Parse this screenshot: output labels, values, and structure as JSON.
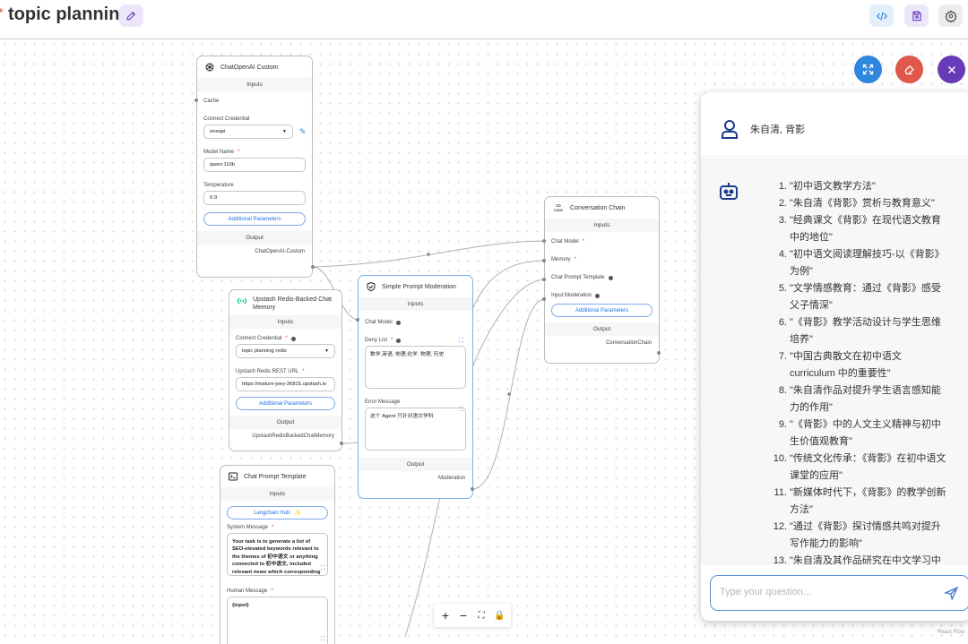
{
  "header": {
    "unsaved_marker": "*",
    "title": "topic planning"
  },
  "colors": {
    "accent_purple": "#673ab7",
    "expand_fab": "#2e86de",
    "clear_fab": "#e0584a",
    "close_fab": "#673ab7"
  },
  "nodes": {
    "chatopenai": {
      "title": "ChatOpenAI Custom",
      "inputs_label": "Inputs",
      "cache_label": "Cache",
      "credential_label": "Connect Credential",
      "credential_value": "oneapi",
      "model_label": "Model Name",
      "model_value": "qwen:110b",
      "temperature_label": "Temperature",
      "temperature_value": "0.9",
      "additional_params": "Additional Parameters",
      "output_label": "Output",
      "output_name": "ChatOpenAI-Custom"
    },
    "redis": {
      "title": "Upstash Redis-Backed Chat Memory",
      "inputs_label": "Inputs",
      "credential_label": "Connect Credential",
      "credential_value": "topic planning redis",
      "url_label": "Upstash Redis REST URL",
      "url_value": "https://mature-joey-36815.upstash.io",
      "additional_params": "Additional Parameters",
      "output_label": "Output",
      "output_name": "UpstashRedisBackedChatMemory"
    },
    "moderation": {
      "title": "Simple Prompt Moderation",
      "inputs_label": "Inputs",
      "chat_model_label": "Chat Model",
      "deny_label": "Deny List",
      "deny_value": "数学,英语, 地理,化学, 物理, 历史",
      "error_label": "Error Message",
      "error_value": "这个 Agent 只针对语文学科",
      "output_label": "Output",
      "output_name": "Moderation"
    },
    "conversation": {
      "icon_text": "CONV",
      "title": "Conversation Chain",
      "inputs_label": "Inputs",
      "chat_model_label": "Chat Model",
      "memory_label": "Memory",
      "prompt_label": "Chat Prompt Template",
      "moderation_label": "Input Moderation",
      "additional_params": "Additional Parameters",
      "output_label": "Output",
      "output_name": "ConversationChain"
    },
    "prompt": {
      "title": "Chat Prompt Template",
      "inputs_label": "Inputs",
      "hub_label": "Langchain Hub",
      "system_label": "System Message",
      "system_value": "Your task is to generate a list of SEO-elevated keywords relevant to the themes of 初中语文 or anything connected to 初中语文, included relevant news which corresponding",
      "human_label": "Human Message",
      "human_value": "{input}"
    }
  },
  "chat": {
    "user_message": "朱自清, 背影",
    "bot_items": [
      {
        "n": "1.",
        "t": "\"初中语文教学方法\""
      },
      {
        "n": "2.",
        "t": "\"朱自清《背影》赏析与教育意义\""
      },
      {
        "n": "3.",
        "t": "\"经典课文《背影》在现代语文教育中的地位\""
      },
      {
        "n": "4.",
        "t": "\"初中语文阅读理解技巧-以《背影》为例\""
      },
      {
        "n": "5.",
        "t": "\"文学情感教育：通过《背影》感受父子情深\""
      },
      {
        "n": "6.",
        "t": "\"《背影》教学活动设计与学生思维培养\""
      },
      {
        "n": "7.",
        "t": "\"中国古典散文在初中语文 curriculum 中的重要性\""
      },
      {
        "n": "8.",
        "t": "\"朱自清作品对提升学生语言感知能力的作用\""
      },
      {
        "n": "9.",
        "t": "\"《背影》中的人文主义精神与初中生价值观教育\""
      },
      {
        "n": "10.",
        "t": "\"传统文化传承：《背影》在初中语文课堂的应用\""
      },
      {
        "n": "11.",
        "t": "\"新媒体时代下，《背影》的教学创新方法\""
      },
      {
        "n": "12.",
        "t": "\"通过《背影》探讨情感共鸣对提升写作能力的影响\""
      },
      {
        "n": "13.",
        "t": "\"朱自清及其作品研究在中文学习中的"
      }
    ],
    "input_placeholder": "Type your question..."
  },
  "footer": {
    "attribution": "React Flow"
  }
}
